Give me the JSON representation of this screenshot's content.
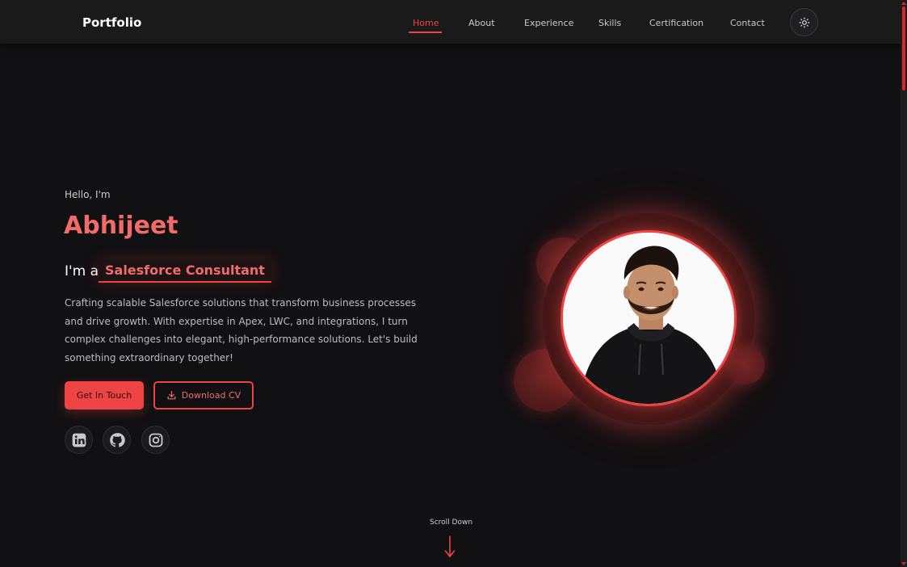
{
  "header": {
    "brand": "Portfolio",
    "nav": [
      {
        "label": "Home",
        "active": true
      },
      {
        "label": "About",
        "active": false
      },
      {
        "label": "Experience",
        "active": false
      },
      {
        "label": "Skills",
        "active": false
      },
      {
        "label": "Certification",
        "active": false
      },
      {
        "label": "Contact",
        "active": false
      }
    ],
    "theme_toggle_icon": "sun-icon"
  },
  "hero": {
    "greeting": "Hello, I'm",
    "name": "Abhijeet",
    "role_prefix": "I'm a",
    "role": "Salesforce Consultant",
    "description": "Crafting scalable Salesforce solutions that transform business processes and drive growth. With expertise in Apex, LWC, and integrations, I turn complex challenges into elegant, high-performance solutions. Let's build something extraordinary together!",
    "primary_button": "Get In Touch",
    "secondary_button": "Download CV",
    "secondary_button_icon": "download-icon",
    "socials": [
      {
        "icon": "linkedin-icon"
      },
      {
        "icon": "github-icon"
      },
      {
        "icon": "instagram-icon"
      }
    ]
  },
  "scroll_hint": {
    "label": "Scroll Down",
    "icon": "arrow-down-icon"
  },
  "colors": {
    "accent": "#ef4444",
    "accent_text": "#f26b6b",
    "background": "#111012",
    "navbar": "#1a1a1b"
  }
}
